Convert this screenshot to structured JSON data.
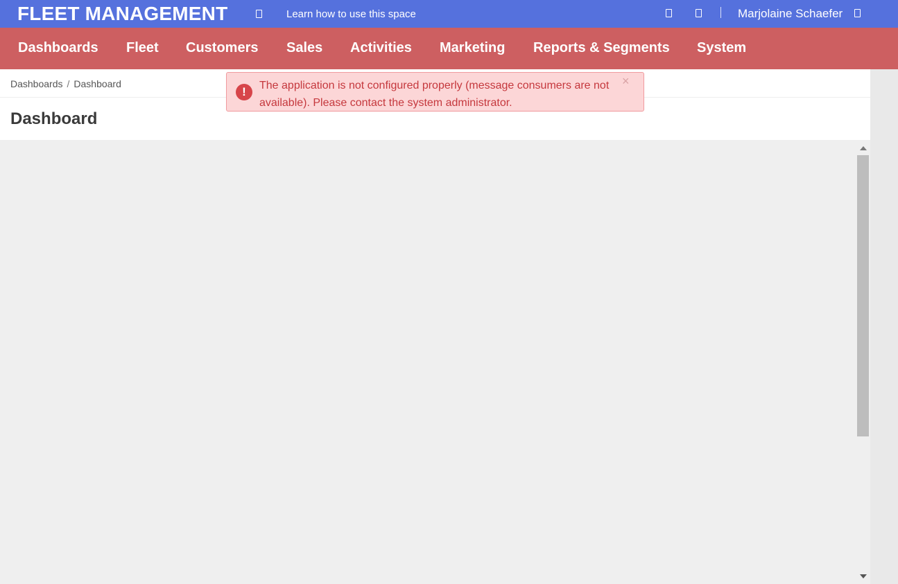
{
  "topbar": {
    "app_title": "FLEET MANAGEMENT",
    "help_link": "Learn how to use this space",
    "user_name": "Marjolaine Schaefer",
    "help_icon": "book-icon",
    "icons": [
      "notification-icon",
      "settings-icon"
    ],
    "user_menu_icon": "chevron-down-icon"
  },
  "nav": {
    "items": [
      {
        "label": "Dashboards"
      },
      {
        "label": "Fleet"
      },
      {
        "label": "Customers"
      },
      {
        "label": "Sales"
      },
      {
        "label": "Activities"
      },
      {
        "label": "Marketing"
      },
      {
        "label": "Reports & Segments"
      },
      {
        "label": "System"
      }
    ]
  },
  "breadcrumb": {
    "items": [
      "Dashboards",
      "Dashboard"
    ],
    "separator": "/"
  },
  "page": {
    "title": "Dashboard"
  },
  "alert": {
    "icon": "!",
    "message": "The application is not configured properly (message consumers are not available). Please contact the system administrator.",
    "close": "×"
  },
  "colors": {
    "topbar": "#5571dd",
    "nav": "#cd5f61",
    "alert_bg": "#fcd6d7",
    "alert_text": "#c5383d"
  }
}
